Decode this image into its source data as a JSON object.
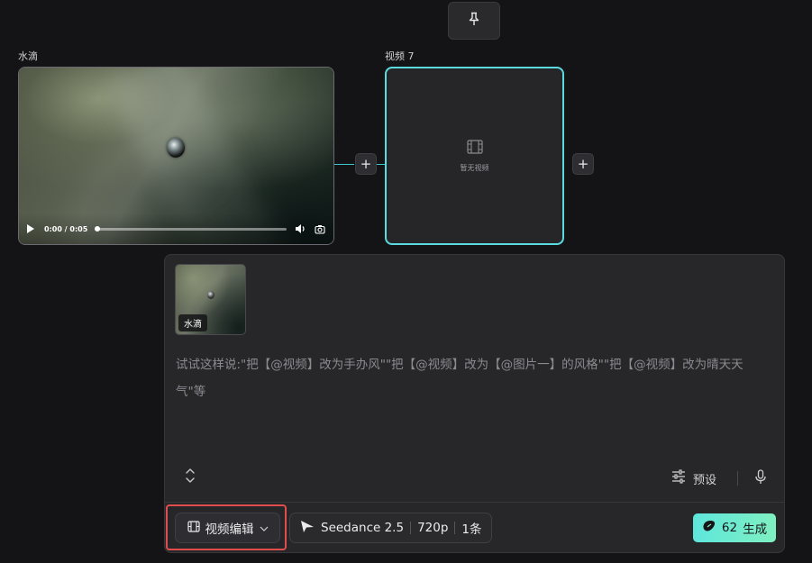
{
  "toolbar": {
    "pin_icon": "pin-icon"
  },
  "nodes": {
    "source": {
      "label": "水滴",
      "player": {
        "time": "0:00 / 0:05",
        "progress": 0
      }
    },
    "target": {
      "label": "视频 7",
      "empty_text": "暂无视频"
    },
    "add_symbol": "+"
  },
  "composer": {
    "attachment_tag": "水滴",
    "prompt_placeholder": "试试这样说:\"把【@视频】改为手办风\"\"把【@视频】改为【@图片一】的风格\"\"把【@视频】改为晴天天气\"等",
    "preset_label": "预设",
    "mode_label": "视频编辑",
    "model": {
      "name": "Seedance 2.5",
      "resolution": "720p",
      "count": "1条"
    },
    "generate": {
      "credits": "62",
      "label": "生成"
    }
  },
  "colors": {
    "accent_cyan": "#5bdbe0",
    "generate_gradient_start": "#5ee6dc",
    "generate_gradient_end": "#7ff0c0",
    "highlight_red": "#e14d4d"
  }
}
